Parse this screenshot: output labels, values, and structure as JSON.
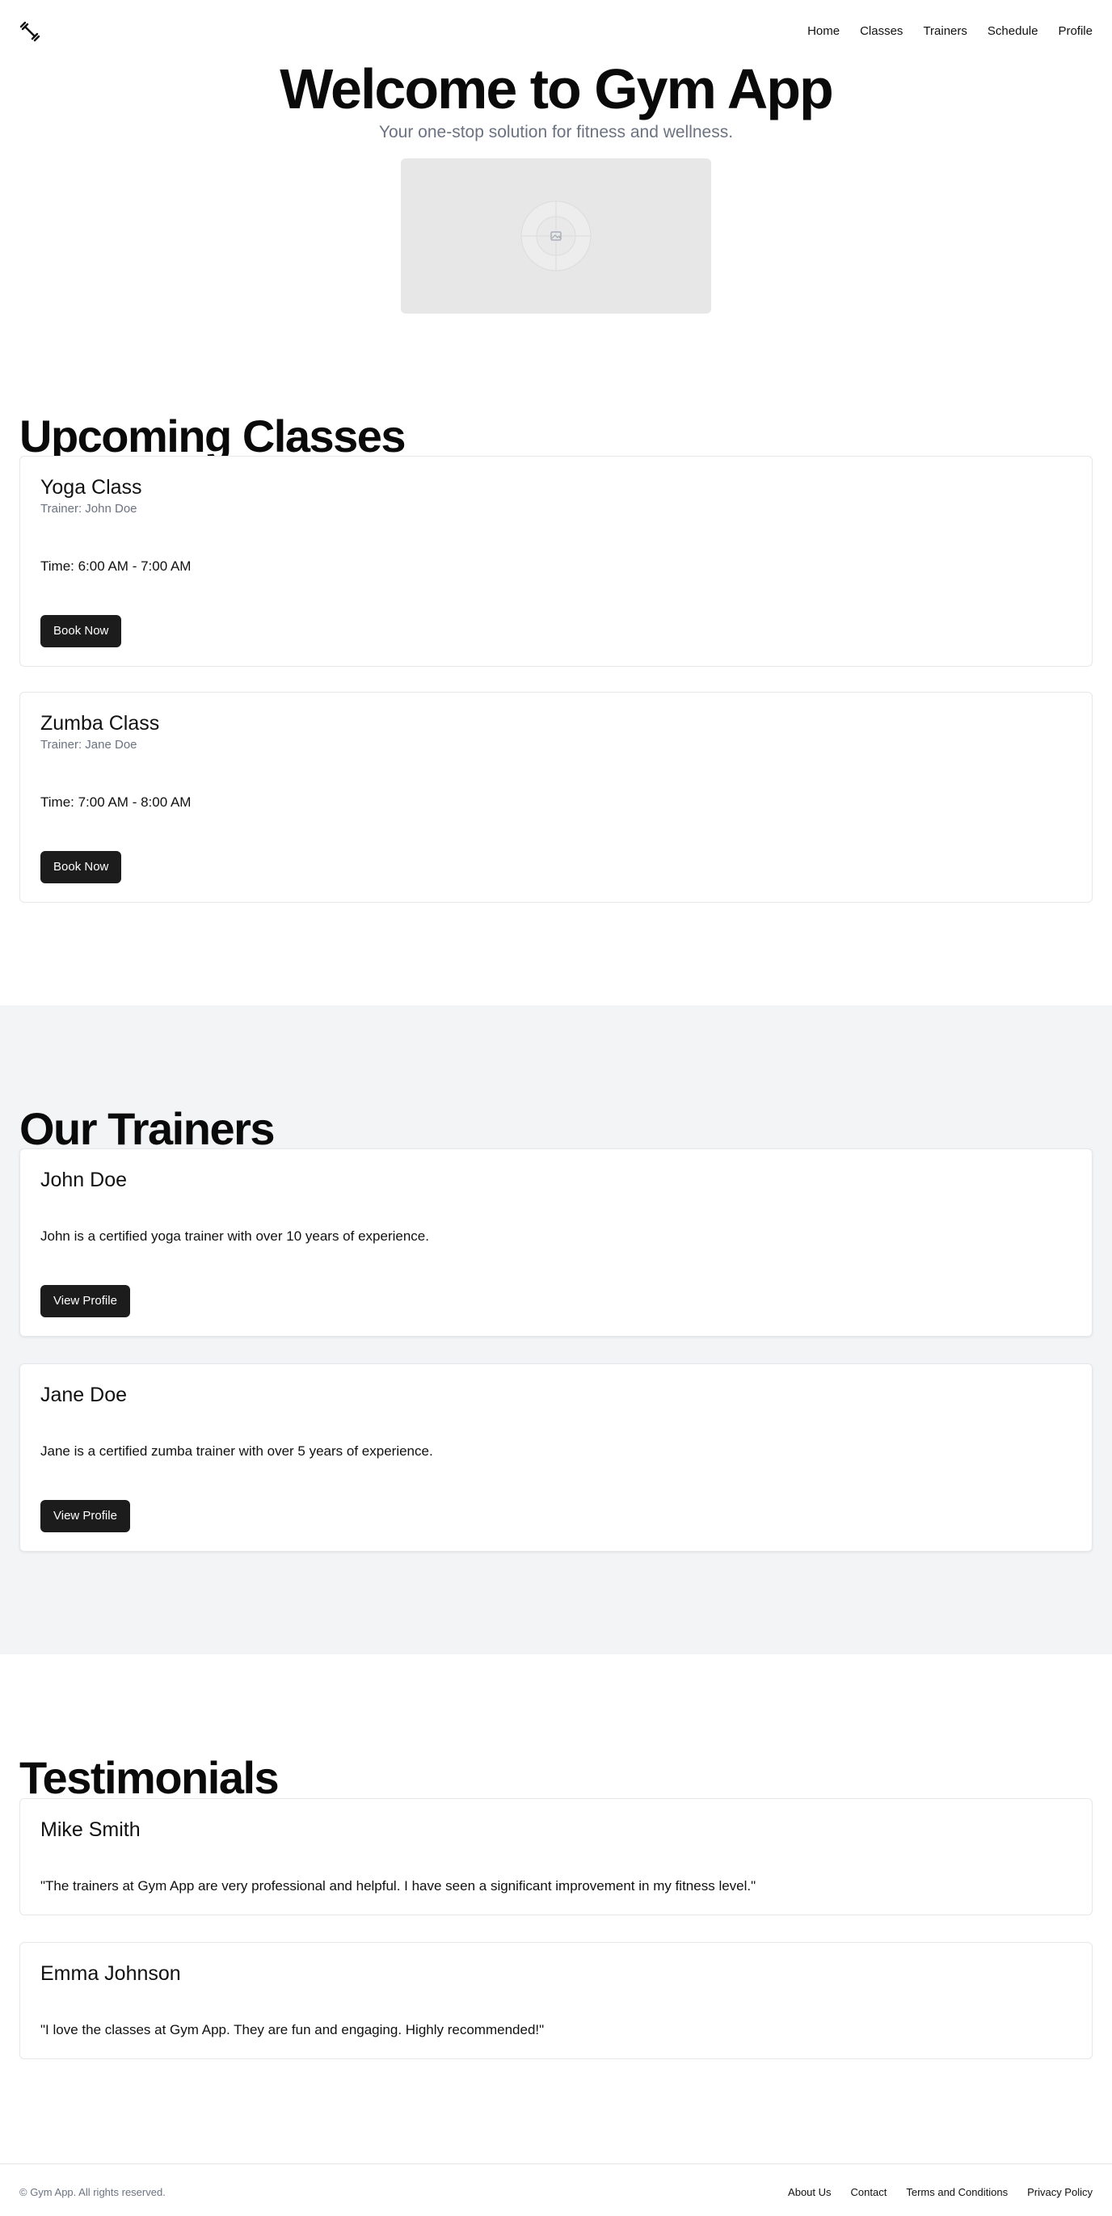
{
  "header": {
    "logo_icon": "dumbbell-icon",
    "nav": [
      {
        "label": "Home"
      },
      {
        "label": "Classes"
      },
      {
        "label": "Trainers"
      },
      {
        "label": "Schedule"
      },
      {
        "label": "Profile"
      }
    ]
  },
  "hero": {
    "title": "Welcome to Gym App",
    "subtitle": "Your one-stop solution for fitness and wellness.",
    "image_icon": "image-placeholder-icon"
  },
  "classes": {
    "title": "Upcoming Classes",
    "items": [
      {
        "name": "Yoga Class",
        "trainer": "Trainer: John Doe",
        "time": "Time: 6:00 AM - 7:00 AM",
        "button": "Book Now"
      },
      {
        "name": "Zumba Class",
        "trainer": "Trainer: Jane Doe",
        "time": "Time: 7:00 AM - 8:00 AM",
        "button": "Book Now"
      }
    ]
  },
  "trainers": {
    "title": "Our Trainers",
    "items": [
      {
        "name": "John Doe",
        "bio": "John is a certified yoga trainer with over 10 years of experience.",
        "button": "View Profile"
      },
      {
        "name": "Jane Doe",
        "bio": "Jane is a certified zumba trainer with over 5 years of experience.",
        "button": "View Profile"
      }
    ]
  },
  "testimonials": {
    "title": "Testimonials",
    "items": [
      {
        "name": "Mike Smith",
        "quote": "\"The trainers at Gym App are very professional and helpful. I have seen a significant improvement in my fitness level.\""
      },
      {
        "name": "Emma Johnson",
        "quote": "\"I love the classes at Gym App. They are fun and engaging. Highly recommended!\""
      }
    ]
  },
  "footer": {
    "copyright": "© Gym App. All rights reserved.",
    "links": [
      {
        "label": "About Us"
      },
      {
        "label": "Contact"
      },
      {
        "label": "Terms and Conditions"
      },
      {
        "label": "Privacy Policy"
      }
    ]
  },
  "colors": {
    "button_bg": "#1c1c1c",
    "muted_text": "#6b7280",
    "band_bg": "#f3f4f6"
  }
}
